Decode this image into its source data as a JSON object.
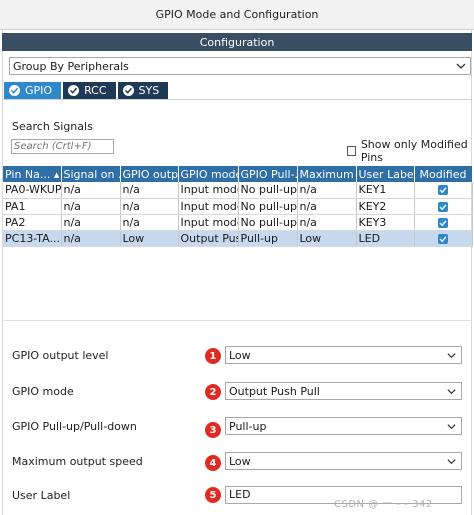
{
  "window": {
    "title": "GPIO Mode and Configuration",
    "section": "Configuration"
  },
  "group_by": {
    "value": "Group By Peripherals",
    "icon": "chevron-down-icon"
  },
  "tabs": [
    {
      "label": "GPIO",
      "icon": "check-circle-icon",
      "active": true
    },
    {
      "label": "RCC",
      "icon": "check-circle-icon",
      "active": false
    },
    {
      "label": "SYS",
      "icon": "check-circle-icon",
      "active": false
    }
  ],
  "search": {
    "label": "Search Signals",
    "placeholder": "Search (Crtl+F)",
    "show_modified_label": "Show only Modified Pins",
    "show_modified_checked": false
  },
  "table": {
    "columns": [
      "Pin Na...",
      "Signal on ...",
      "GPIO outp...",
      "GPIO mode",
      "GPIO Pull-...",
      "Maximum ...",
      "User Label",
      "Modified"
    ],
    "rows": [
      {
        "pin": "PA0-WKUP",
        "signal": "n/a",
        "output": "n/a",
        "mode": "Input mode",
        "pull": "No pull-up ...",
        "speed": "n/a",
        "label": "KEY1",
        "modified": true,
        "selected": false
      },
      {
        "pin": "PA1",
        "signal": "n/a",
        "output": "n/a",
        "mode": "Input mode",
        "pull": "No pull-up ...",
        "speed": "n/a",
        "label": "KEY2",
        "modified": true,
        "selected": false
      },
      {
        "pin": "PA2",
        "signal": "n/a",
        "output": "n/a",
        "mode": "Input mode",
        "pull": "No pull-up ...",
        "speed": "n/a",
        "label": "KEY3",
        "modified": true,
        "selected": false
      },
      {
        "pin": "PC13-TA...",
        "signal": "n/a",
        "output": "Low",
        "mode": "Output Pus...",
        "pull": "Pull-up",
        "speed": "Low",
        "label": "LED",
        "modified": true,
        "selected": true
      }
    ]
  },
  "properties": [
    {
      "label": "GPIO output level",
      "value": "Low",
      "badge": "1",
      "kind": "select"
    },
    {
      "label": "GPIO mode",
      "value": "Output Push Pull",
      "badge": "2",
      "kind": "select"
    },
    {
      "label": "GPIO Pull-up/Pull-down",
      "value": "Pull-up",
      "badge": "3",
      "kind": "select"
    },
    {
      "label": "Maximum output speed",
      "value": "Low",
      "badge": "4",
      "kind": "select"
    },
    {
      "label": "User Label",
      "value": "LED",
      "badge": "5",
      "kind": "input"
    }
  ],
  "colors": {
    "header_dark": "#3a4e63",
    "tab_active": "#2e88cc",
    "tab_inactive": "#1f3a57",
    "table_header": "#2f6fa8",
    "selected_row": "#c6d9ef",
    "badge_red": "#e02b24"
  },
  "watermark": "CSDN @ 一 -   -  342"
}
